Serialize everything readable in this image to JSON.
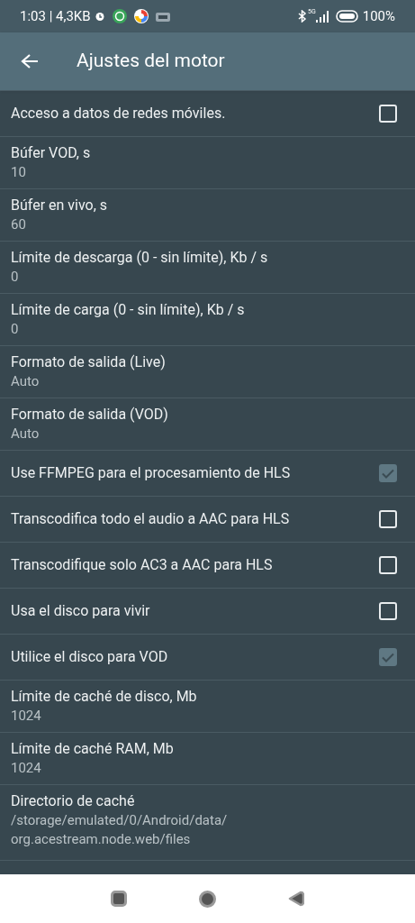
{
  "status_bar": {
    "time": "1:03 | 4,3KB",
    "network": "5G",
    "battery": "100%"
  },
  "toolbar": {
    "title": "Ajustes del motor"
  },
  "settings": [
    {
      "kind": "checkbox",
      "title": "Acceso a datos de redes móviles.",
      "checked": false
    },
    {
      "kind": "value",
      "title": "Búfer VOD, s",
      "value": "10"
    },
    {
      "kind": "value",
      "title": "Búfer en vivo, s",
      "value": "60"
    },
    {
      "kind": "value",
      "title": "Límite de descarga (0 - sin límite), Kb / s",
      "value": "0"
    },
    {
      "kind": "value",
      "title": "Límite de carga (0 - sin límite), Kb / s",
      "value": "0"
    },
    {
      "kind": "value",
      "title": "Formato de salida (Live)",
      "value": "Auto"
    },
    {
      "kind": "value",
      "title": "Formato de salida (VOD)",
      "value": "Auto"
    },
    {
      "kind": "checkbox",
      "title": "Use FFMPEG para el procesamiento de HLS",
      "checked": true
    },
    {
      "kind": "checkbox",
      "title": "Transcodifica todo el audio a AAC para HLS",
      "checked": false
    },
    {
      "kind": "checkbox",
      "title": "Transcodifique solo AC3 a AAC para HLS",
      "checked": false
    },
    {
      "kind": "checkbox",
      "title": "Usa el disco para vivir",
      "checked": false
    },
    {
      "kind": "checkbox",
      "title": "Utilice el disco para VOD",
      "checked": true
    },
    {
      "kind": "value",
      "title": "Límite de caché de disco, Mb",
      "value": "1024"
    },
    {
      "kind": "value",
      "title": "Límite de caché RAM, Mb",
      "value": "1024"
    },
    {
      "kind": "value",
      "title": "Directorio de caché",
      "value": "/storage/emulated/0/Android/data/\norg.acestream.node.web/files"
    }
  ]
}
